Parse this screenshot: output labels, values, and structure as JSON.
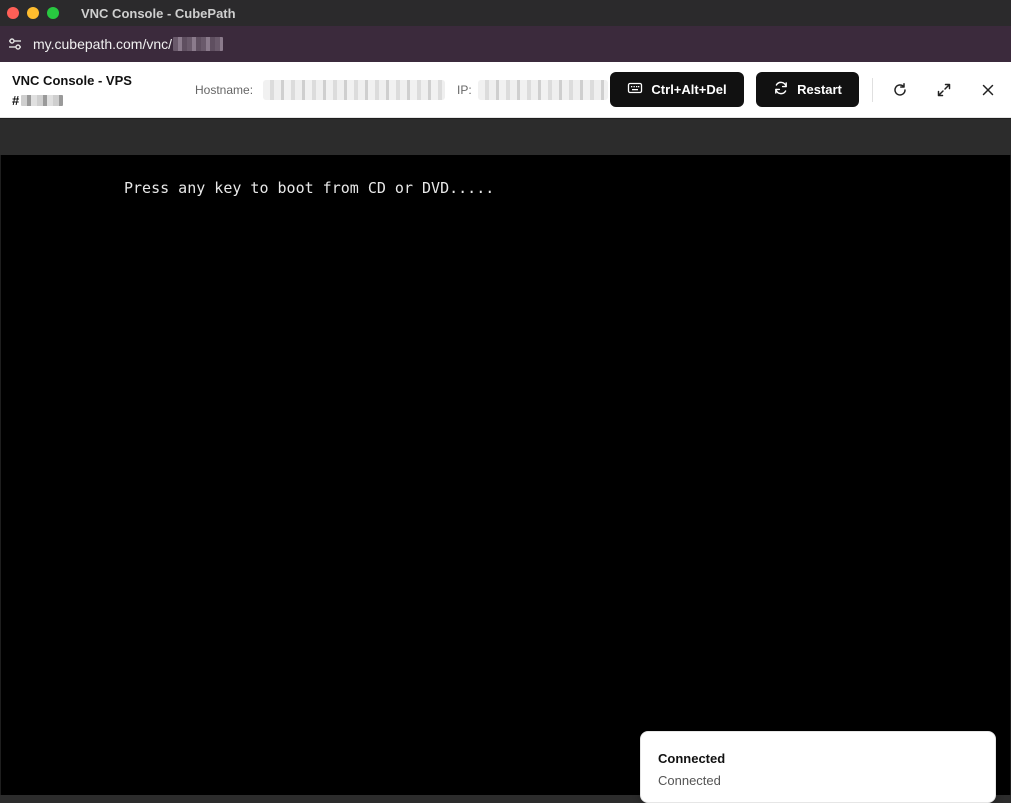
{
  "window": {
    "title": "VNC Console - CubePath"
  },
  "urlbar": {
    "url": "my.cubepath.com/vnc/"
  },
  "header": {
    "title": "VNC Console - VPS",
    "vps_id_prefix": "#",
    "hostname_label": "Hostname:",
    "ip_label": "IP:",
    "ctrl_alt_del_label": "Ctrl+Alt+Del",
    "restart_label": "Restart"
  },
  "console": {
    "text": "Press any key to boot from CD or DVD....."
  },
  "toast": {
    "title": "Connected",
    "description": "Connected"
  },
  "icons": {
    "site_settings": "site-settings-icon",
    "keyboard": "keyboard-icon",
    "restart": "restart-icon",
    "refresh": "refresh-icon",
    "fullscreen": "fullscreen-icon",
    "close": "close-icon"
  }
}
